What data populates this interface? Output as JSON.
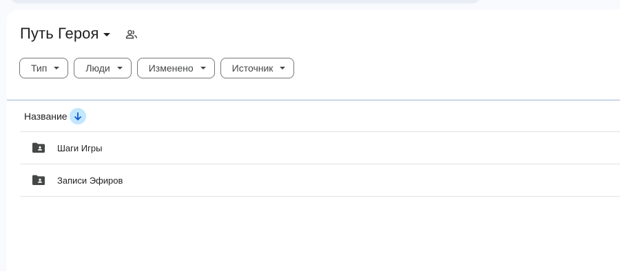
{
  "header": {
    "title": "Путь Героя"
  },
  "filters": [
    {
      "label": "Тип"
    },
    {
      "label": "Люди"
    },
    {
      "label": "Изменено"
    },
    {
      "label": "Источник"
    }
  ],
  "list": {
    "column_name": "Название",
    "sort_direction": "descending",
    "items": [
      {
        "name": "Шаги Игры",
        "icon": "shared-folder-icon"
      },
      {
        "name": "Записи Эфиров",
        "icon": "shared-folder-icon"
      }
    ]
  },
  "colors": {
    "accent_sort_bg": "#c2e7ff",
    "accent_sort_arrow": "#0b57d0",
    "text": "#1f1f1f",
    "divider": "#e1e3e1"
  }
}
